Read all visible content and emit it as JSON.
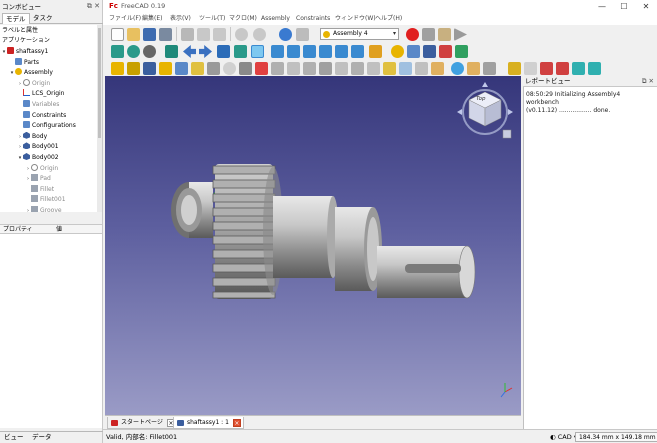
{
  "combo": {
    "title": "コンボビュー",
    "tabs": [
      "モデル",
      "タスク"
    ],
    "labels_header": "ラベルと属性",
    "app_label": "アプリケーション",
    "tree": [
      {
        "label": "shaftassy1",
        "indent": 0,
        "icon": "doc",
        "twisty": "▾",
        "gray": false
      },
      {
        "label": "Parts",
        "indent": 1,
        "icon": "folder",
        "twisty": "",
        "gray": false
      },
      {
        "label": "Assembly",
        "indent": 1,
        "icon": "asm",
        "twisty": "▾",
        "gray": false
      },
      {
        "label": "Origin",
        "indent": 2,
        "icon": "origin",
        "twisty": "›",
        "gray": true
      },
      {
        "label": "LCS_Origin",
        "indent": 2,
        "icon": "lcs",
        "twisty": "",
        "gray": false
      },
      {
        "label": "Variables",
        "indent": 2,
        "icon": "folder",
        "twisty": "",
        "gray": true
      },
      {
        "label": "Constraints",
        "indent": 2,
        "icon": "folder",
        "twisty": "",
        "gray": false
      },
      {
        "label": "Configurations",
        "indent": 2,
        "icon": "folder",
        "twisty": "",
        "gray": false
      },
      {
        "label": "Body",
        "indent": 2,
        "icon": "body",
        "twisty": "›",
        "gray": false
      },
      {
        "label": "Body001",
        "indent": 2,
        "icon": "body",
        "twisty": "›",
        "gray": false
      },
      {
        "label": "Body002",
        "indent": 2,
        "icon": "body",
        "twisty": "▾",
        "gray": false
      },
      {
        "label": "Origin",
        "indent": 3,
        "icon": "origin",
        "twisty": "›",
        "gray": true
      },
      {
        "label": "Pad",
        "indent": 3,
        "icon": "feat",
        "twisty": "›",
        "gray": true
      },
      {
        "label": "Fillet",
        "indent": 3,
        "icon": "feat",
        "twisty": "",
        "gray": true
      },
      {
        "label": "Fillet001",
        "indent": 3,
        "icon": "feat",
        "twisty": "",
        "gray": true
      },
      {
        "label": "Groove",
        "indent": 3,
        "icon": "feat",
        "twisty": "›",
        "gray": true
      }
    ],
    "prop_col1": "プロパティ",
    "prop_col2": "値",
    "bottom_tabs": [
      "ビュー",
      "データ"
    ]
  },
  "window": {
    "title": "FreeCAD 0.19",
    "controls": [
      "—",
      "☐",
      "✕"
    ]
  },
  "menu": [
    "ファイル(F)",
    "編集(E)",
    "表示(V)",
    "ツール(T)",
    "マクロ(M)",
    "Assembly",
    "Constraints",
    "ウィンドウ(W)",
    "ヘルプ(H)"
  ],
  "workbench": {
    "selected": "Assembly 4"
  },
  "viewport": {
    "navcube_face": "Top"
  },
  "doc_tabs": [
    {
      "label": "スタートページ",
      "active": false
    },
    {
      "label": "shaftassy1 : 1",
      "active": true
    }
  ],
  "report": {
    "title": "レポートビュー",
    "lines": [
      "08:50:29  Initializing Assembly4 workbench",
      "(v0.11.12) ................. done."
    ]
  },
  "status": {
    "message": "Valid, 内部名: Fillet001",
    "nav_style": "CAD",
    "dimensions": "184.34 mm x 149.18 mm"
  },
  "colors": {
    "doc_red": "#cc2222",
    "assembly_yellow": "#e8b400",
    "body_blue": "#3b5e9e",
    "viewport_top": "#35367a",
    "viewport_bottom": "#9a9bc6"
  }
}
